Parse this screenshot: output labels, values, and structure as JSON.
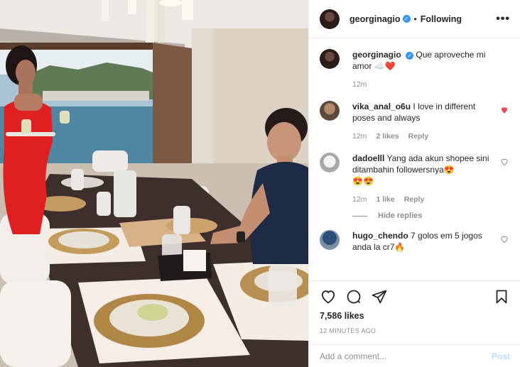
{
  "post": {
    "username": "georginagio",
    "verified_glyph": "✓",
    "separator": "•",
    "follow_status": "Following",
    "more_glyph": "•••"
  },
  "caption": {
    "username": "georginagio",
    "verified_glyph": "✓",
    "text": "Que aproveche mi amor",
    "emoji": "☁️❤️",
    "age": "12m"
  },
  "comments": [
    {
      "username": "vika_anal_o6u",
      "text": "I love in different poses and always",
      "age": "12m",
      "likes": "2 likes",
      "reply": "Reply",
      "liked": true
    },
    {
      "username": "dadoelll",
      "text": "Yang ada akun shopee sini ditambahin followersnya😍",
      "emoji": "😍😍",
      "age": "12m",
      "likes": "1 like",
      "reply": "Reply",
      "liked": false
    },
    {
      "username": "hugo_chendo",
      "text": "7 golos em 5 jogos anda la cr7🔥",
      "liked": false
    }
  ],
  "hide_replies": "Hide replies",
  "likes": "7,586 likes",
  "posted": "12 MINUTES AGO",
  "add_comment": {
    "placeholder": "Add a comment...",
    "post": "Post"
  },
  "colors": {
    "accent": "#3897f0",
    "heart": "#ed4956",
    "muted": "#8e8e8e",
    "post_disabled": "#b2dffc"
  }
}
